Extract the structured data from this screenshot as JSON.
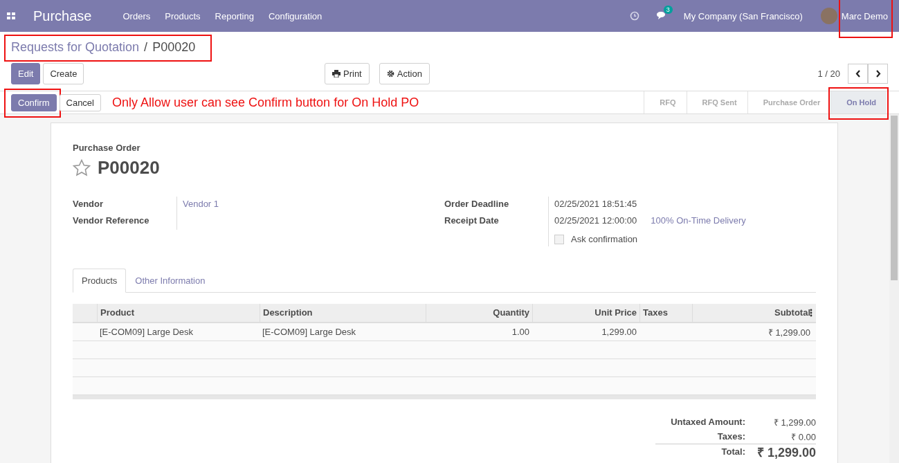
{
  "navbar": {
    "app_name": "Purchase",
    "menu": [
      "Orders",
      "Products",
      "Reporting",
      "Configuration"
    ],
    "chat_count": "3",
    "company": "My Company (San Francisco)",
    "user": "Marc Demo",
    "user_highlighted": true
  },
  "breadcrumb": {
    "parent": "Requests for Quotation",
    "separator": "/",
    "current": "P00020",
    "highlighted": true
  },
  "control_panel": {
    "buttons": [
      {
        "label": "Edit",
        "kind": "primary"
      },
      {
        "label": "Create",
        "kind": "secondary"
      }
    ],
    "actions": [
      {
        "label": "Print",
        "kind": "print"
      },
      {
        "label": "Action",
        "kind": "gear"
      }
    ],
    "pager": "1 / 20"
  },
  "statusbar": {
    "buttons": [
      {
        "label": "Confirm",
        "kind": "primary",
        "highlighted": true
      },
      {
        "label": "Cancel",
        "kind": "secondary"
      }
    ],
    "note": "Only Allow user can see Confirm button for On Hold PO",
    "stages": [
      {
        "label": "RFQ",
        "selected": false,
        "highlighted": false
      },
      {
        "label": "RFQ Sent",
        "selected": false,
        "highlighted": false
      },
      {
        "label": "Purchase Order",
        "selected": false,
        "highlighted": false
      },
      {
        "label": "On Hold",
        "selected": true,
        "highlighted": true
      }
    ]
  },
  "sheet": {
    "subtitle": "Purchase Order",
    "name": "P00020",
    "starred": false,
    "fields_left": [
      {
        "label": "Vendor",
        "value": "Vendor 1"
      },
      {
        "label": "Vendor Reference"
      }
    ],
    "fields_right": [
      {
        "label": "Order Deadline",
        "value": "02/25/2021 18:51:45"
      },
      {
        "label": "Receipt Date",
        "value": "02/25/2021 12:00:00",
        "extra": "100% On-Time Delivery"
      }
    ],
    "ask_confirmation": {
      "label": "Ask confirmation",
      "checked": false
    },
    "tabs": [
      {
        "label": "Products",
        "selected": true
      },
      {
        "label": "Other Information",
        "selected": false
      }
    ],
    "table": {
      "columns": [
        {
          "label": "Product"
        },
        {
          "label": "Description"
        },
        {
          "label": "Quantity"
        },
        {
          "label": "Unit Price"
        },
        {
          "label": "Taxes"
        },
        {
          "label": "Subtotal"
        }
      ],
      "rows": [
        [
          "[E-COM09] Large Desk",
          "[E-COM09] Large Desk",
          "1.00",
          "1,299.00",
          "",
          "₹ 1,299.00"
        ]
      ]
    },
    "totals": [
      {
        "label": "Untaxed Amount:",
        "value": "₹ 1,299.00",
        "kind": "normal"
      },
      {
        "label": "Taxes:",
        "value": "₹ 0.00",
        "kind": "normal"
      },
      {
        "label": "Total:",
        "value": "₹ 1,299.00",
        "kind": "grand"
      }
    ]
  }
}
